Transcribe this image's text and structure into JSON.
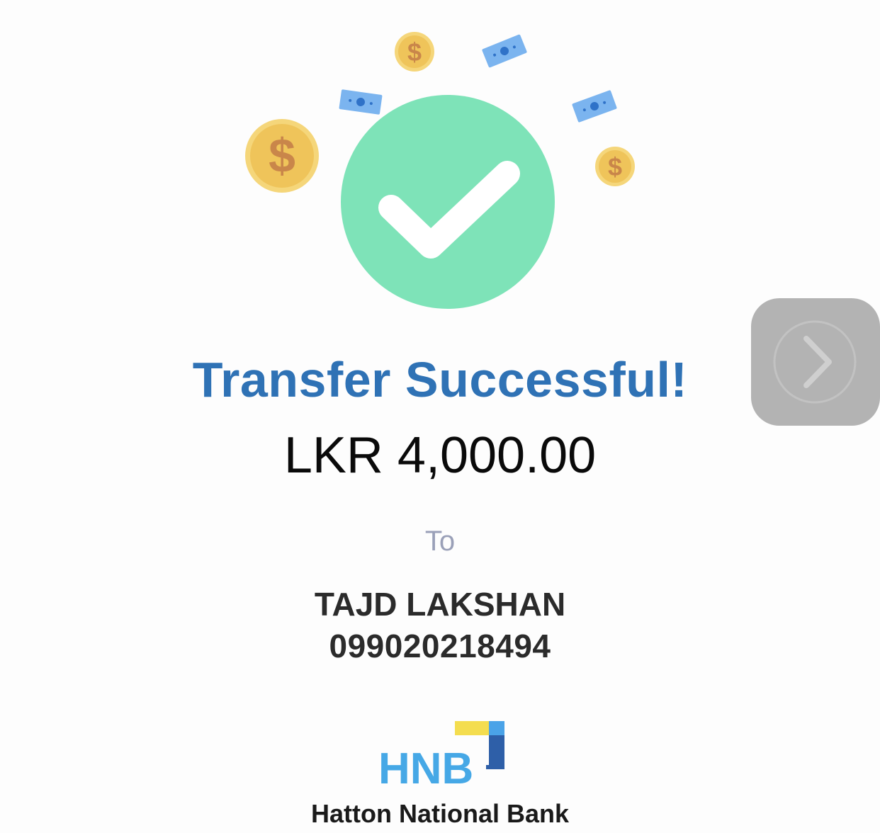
{
  "status": {
    "title": "Transfer Successful!",
    "amount": "LKR 4,000.00"
  },
  "recipient": {
    "label": "To",
    "name": "TAJD LAKSHAN",
    "account_number": "099020218494"
  },
  "bank": {
    "logo_text": "HNB",
    "name": "Hatton National Bank"
  },
  "icons": {
    "success": "check-circle-icon",
    "coin": "dollar-coin-icon",
    "bill": "banknote-icon",
    "next": "chevron-right-icon"
  },
  "colors": {
    "title": "#2f72b5",
    "check_circle": "#7ee3b8",
    "coin": "#f2c75c",
    "bill": "#7bb4ef",
    "logo_blue": "#46a8e6",
    "logo_yellow": "#f4dd4f",
    "logo_navy": "#2e5fa8",
    "to_label": "#9aa0b8"
  }
}
